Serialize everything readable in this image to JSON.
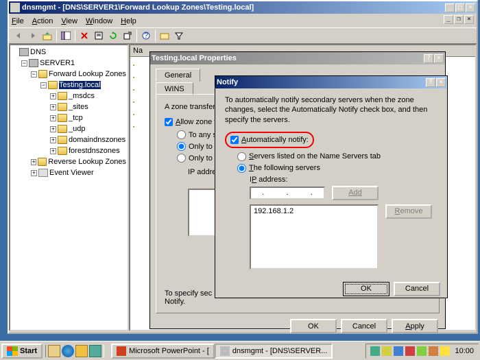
{
  "window": {
    "title": "dnsmgmt - [DNS\\SERVER1\\Forward Lookup Zones\\Testing.local]"
  },
  "menus": {
    "file": "File",
    "action": "Action",
    "view": "View",
    "window": "Window",
    "help": "Help"
  },
  "tree": {
    "root": "DNS",
    "server": "SERVER1",
    "flz": "Forward Lookup Zones",
    "zone": "Testing.local",
    "sub": [
      "_msdcs",
      "_sites",
      "_tcp",
      "_udp",
      "domaindnszones",
      "forestdnszones"
    ],
    "rlz": "Reverse Lookup Zones",
    "ev": "Event Viewer"
  },
  "list_head": "Na",
  "props": {
    "title": "Testing.local Properties",
    "tabs": {
      "general": "General",
      "wins": "WINS"
    },
    "zt_label": "A zone transfer se",
    "allow": "Allow zone tra",
    "r1": "To any ser",
    "r2": "Only to ser",
    "r3": "Only to the",
    "ip_label": "IP address",
    "note": "To specify sec",
    "note2": "Notify.",
    "ok": "OK",
    "cancel": "Cancel",
    "apply": "Apply"
  },
  "notify": {
    "title": "Notify",
    "desc": "To automatically notify secondary servers when the zone changes, select the Automatically Notify check box, and then specify the servers.",
    "auto": "Automatically notify:",
    "r1": "Servers listed on the Name Servers tab",
    "r2": "The following servers",
    "ip_label": "IP address:",
    "add": "Add",
    "remove": "Remove",
    "ip_value": "192.168.1.2",
    "ok": "OK",
    "cancel": "Cancel"
  },
  "taskbar": {
    "start": "Start",
    "tasks": [
      "Microsoft PowerPoint - [",
      "dnsmgmt - [DNS\\SERVER..."
    ],
    "time": "10:00"
  }
}
